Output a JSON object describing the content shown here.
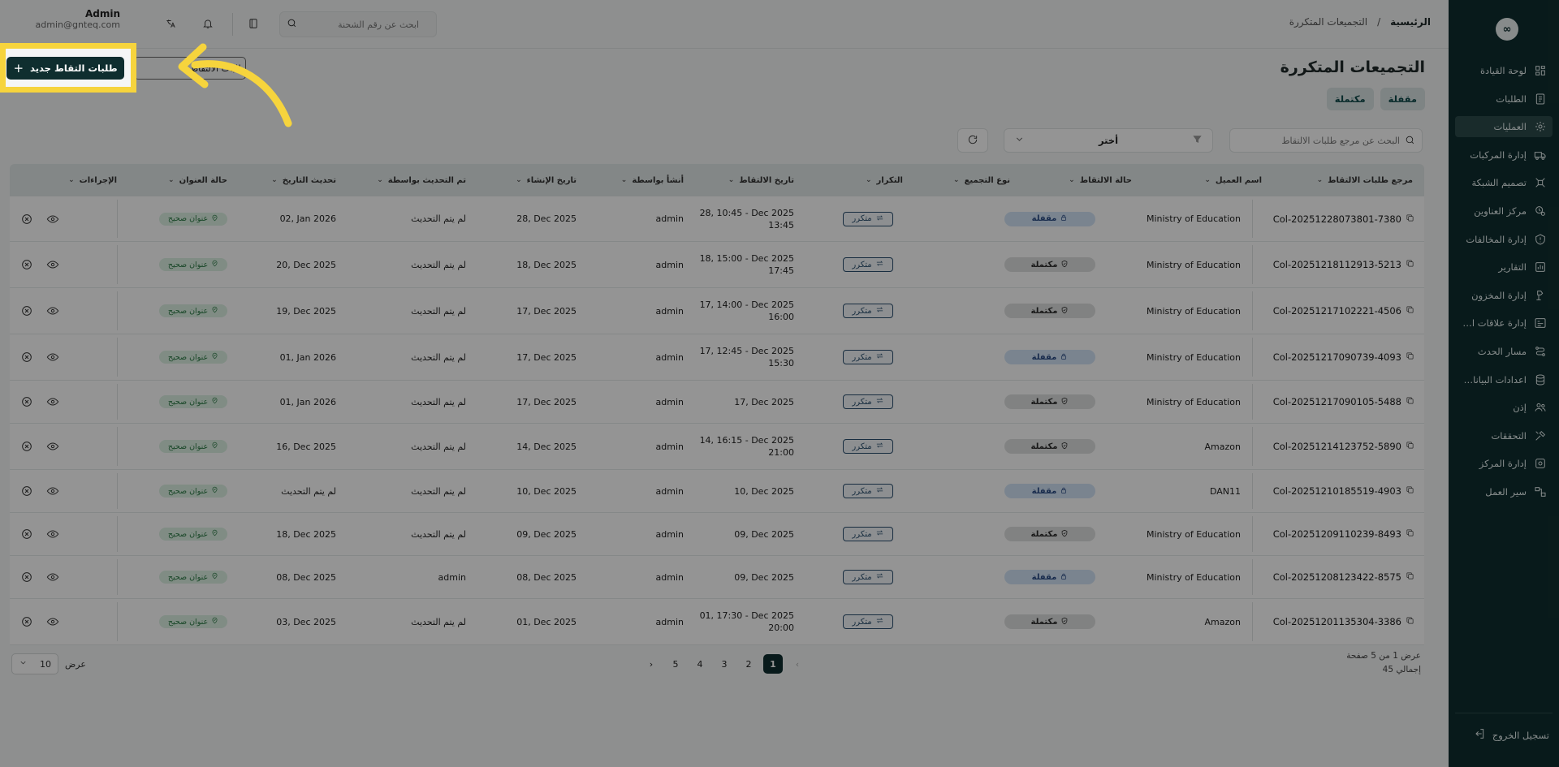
{
  "sidebar": {
    "logo": "∞",
    "items": [
      {
        "label": "لوحة القيادة",
        "icon": "dashboard-icon",
        "active": false
      },
      {
        "label": "الطلبات",
        "icon": "orders-icon",
        "active": false
      },
      {
        "label": "العمليات",
        "icon": "operations-icon",
        "active": true
      },
      {
        "label": "إدارة المركبات",
        "icon": "truck-icon",
        "active": false
      },
      {
        "label": "تصميم الشبكة",
        "icon": "network-icon",
        "active": false
      },
      {
        "label": "مركز العناوين",
        "icon": "address-icon",
        "active": false
      },
      {
        "label": "إدارة المخالفات",
        "icon": "violation-icon",
        "active": false
      },
      {
        "label": "التقارير",
        "icon": "reports-icon",
        "active": false
      },
      {
        "label": "إدارة المخزون",
        "icon": "inventory-icon",
        "active": false
      },
      {
        "label": "إدارة علاقات العملاء",
        "icon": "crm-icon",
        "active": false
      },
      {
        "label": "مسار الحدث",
        "icon": "event-path-icon",
        "active": false
      },
      {
        "label": "اعدادات البيانات...",
        "icon": "database-icon",
        "active": false
      },
      {
        "label": "إذن",
        "icon": "users-icon",
        "active": false
      },
      {
        "label": "التحققات",
        "icon": "tools-icon",
        "active": false
      },
      {
        "label": "إدارة المركز",
        "icon": "center-settings-icon",
        "active": false
      },
      {
        "label": "سير العمل",
        "icon": "workflow-icon",
        "active": false
      }
    ],
    "logout": "تسجيل الخروج"
  },
  "topbar": {
    "breadcrumb_home": "الرئيسية",
    "breadcrumb_sep": "/",
    "breadcrumb_current": "التجميعات المتكررة",
    "search_placeholder": "ابحث عن رقم الشحنة",
    "user_name": "Admin",
    "user_email": "admin@gnteq.com"
  },
  "page": {
    "title": "التجميعات المتكررة",
    "tabs": [
      "مقفلة",
      "مكتملة"
    ],
    "new_button": "طلبات التقاط جديد",
    "outline_button": "طلبات الالتقاط",
    "search_placeholder": "البحث عن مرجع طلبات الالتقاط",
    "filter_label": "أختر"
  },
  "table": {
    "headers": {
      "ref": "مرجع طلبات الالتقاط",
      "client": "اسم العميل",
      "status": "حالة الالتقاط",
      "group_type": "نوع التجميع",
      "repeat": "التكرار",
      "pickup_date": "تاريخ الالتقاط",
      "created_by": "أنشأ بواسطة",
      "created_at": "تاريخ الإنشاء",
      "updated_by": "تم التحديث بواسطة",
      "updated_at": "تحديث التاريخ",
      "address_status": "حالة العنوان",
      "actions": "الإجراءات"
    },
    "rows": [
      {
        "ref": "Col-20251228073801-7380",
        "client": "Ministry of Education",
        "status": "مقفلة",
        "status_kind": "locked",
        "repeat": "متكرر",
        "pickup_line1": "28, 10:45 - Dec 2025",
        "pickup_line2": "13:45",
        "created_by": "admin",
        "created_at": "28, Dec 2025",
        "updated_by": "لم يتم التحديث",
        "updated_at": "02, Jan 2026",
        "address": "عنوان صحيح"
      },
      {
        "ref": "Col-20251218112913-5213",
        "client": "Ministry of Education",
        "status": "مكتملة",
        "status_kind": "done",
        "repeat": "متكرر",
        "pickup_line1": "18, 15:00 - Dec 2025",
        "pickup_line2": "17:45",
        "created_by": "admin",
        "created_at": "18, Dec 2025",
        "updated_by": "لم يتم التحديث",
        "updated_at": "20, Dec 2025",
        "address": "عنوان صحيح"
      },
      {
        "ref": "Col-20251217102221-4506",
        "client": "Ministry of Education",
        "status": "مكتملة",
        "status_kind": "done",
        "repeat": "متكرر",
        "pickup_line1": "17, 14:00 - Dec 2025",
        "pickup_line2": "16:00",
        "created_by": "admin",
        "created_at": "17, Dec 2025",
        "updated_by": "لم يتم التحديث",
        "updated_at": "19, Dec 2025",
        "address": "عنوان صحيح"
      },
      {
        "ref": "Col-20251217090739-4093",
        "client": "Ministry of Education",
        "status": "مقفلة",
        "status_kind": "locked",
        "repeat": "متكرر",
        "pickup_line1": "17, 12:45 - Dec 2025",
        "pickup_line2": "15:30",
        "created_by": "admin",
        "created_at": "17, Dec 2025",
        "updated_by": "لم يتم التحديث",
        "updated_at": "01, Jan 2026",
        "address": "عنوان صحيح"
      },
      {
        "ref": "Col-20251217090105-5488",
        "client": "Ministry of Education",
        "status": "مكتملة",
        "status_kind": "done",
        "repeat": "متكرر",
        "pickup_line1": "17, Dec 2025",
        "pickup_line2": "",
        "created_by": "admin",
        "created_at": "17, Dec 2025",
        "updated_by": "لم يتم التحديث",
        "updated_at": "01, Jan 2026",
        "address": "عنوان صحيح"
      },
      {
        "ref": "Col-20251214123752-5890",
        "client": "Amazon",
        "status": "مكتملة",
        "status_kind": "done",
        "repeat": "متكرر",
        "pickup_line1": "14, 16:15 - Dec 2025",
        "pickup_line2": "21:00",
        "created_by": "admin",
        "created_at": "14, Dec 2025",
        "updated_by": "لم يتم التحديث",
        "updated_at": "16, Dec 2025",
        "address": "عنوان صحيح"
      },
      {
        "ref": "Col-20251210185519-4903",
        "client": "DAN11",
        "status": "مقفلة",
        "status_kind": "locked",
        "repeat": "متكرر",
        "pickup_line1": "10, Dec 2025",
        "pickup_line2": "",
        "created_by": "admin",
        "created_at": "10, Dec 2025",
        "updated_by": "لم يتم التحديث",
        "updated_at": "لم يتم التحديث",
        "address": "عنوان صحيح"
      },
      {
        "ref": "Col-20251209110239-8493",
        "client": "Ministry of Education",
        "status": "مكتملة",
        "status_kind": "done",
        "repeat": "متكرر",
        "pickup_line1": "09, Dec 2025",
        "pickup_line2": "",
        "created_by": "admin",
        "created_at": "09, Dec 2025",
        "updated_by": "لم يتم التحديث",
        "updated_at": "18, Dec 2025",
        "address": "عنوان صحيح"
      },
      {
        "ref": "Col-20251208123422-8575",
        "client": "Ministry of Education",
        "status": "مقفلة",
        "status_kind": "locked",
        "repeat": "متكرر",
        "pickup_line1": "09, Dec 2025",
        "pickup_line2": "",
        "created_by": "admin",
        "created_at": "08, Dec 2025",
        "updated_by": "admin",
        "updated_at": "08, Dec 2025",
        "address": "عنوان صحيح"
      },
      {
        "ref": "Col-20251201135304-3386",
        "client": "Amazon",
        "status": "مكتملة",
        "status_kind": "done",
        "repeat": "متكرر",
        "pickup_line1": "01, 17:30 - Dec 2025",
        "pickup_line2": "20:00",
        "created_by": "admin",
        "created_at": "01, Dec 2025",
        "updated_by": "لم يتم التحديث",
        "updated_at": "03, Dec 2025",
        "address": "عنوان صحيح"
      }
    ]
  },
  "pagination": {
    "info_line1": "عرض 1 من 5 صفحة",
    "info_line2": "إجمالي 45",
    "prev": "‹",
    "pages": [
      "1",
      "2",
      "3",
      "4",
      "5"
    ],
    "current": "1",
    "next": "›",
    "per_page_label": "عرض",
    "per_page_value": "10"
  },
  "colors": {
    "sidebar_bg": "#0f2e2f",
    "primary": "#0f2e2f",
    "highlight": "#f6d43d",
    "locked_pill": "#d3e3f7",
    "address_ok": "#dcf1e3"
  }
}
